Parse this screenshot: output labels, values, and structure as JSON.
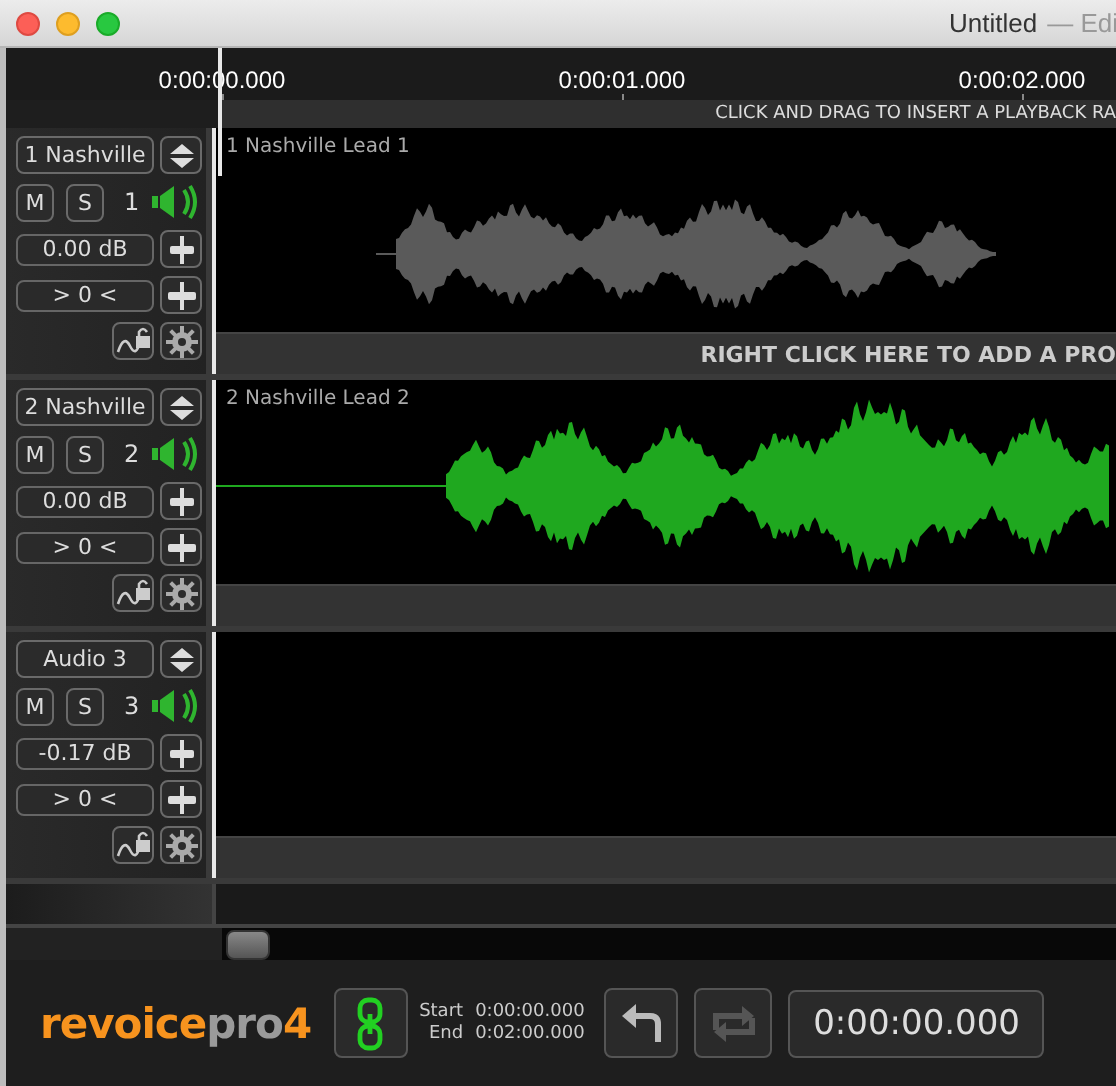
{
  "window": {
    "title": "Untitled",
    "subtitle": "— Edi"
  },
  "ruler": {
    "labels": [
      "0:00:00.000",
      "0:00:01.000",
      "0:00:02.000"
    ]
  },
  "banner": "CLICK AND DRAG TO INSERT A PLAYBACK RA",
  "tracks": [
    {
      "name": "1 Nashville",
      "mute": "M",
      "solo": "S",
      "number": "1",
      "gain": "0.00 dB",
      "pan": "> 0 <",
      "clip": {
        "label": "1 Nashville Lead 1",
        "color": "#5a5a5a"
      },
      "hint": "RIGHT CLICK HERE TO ADD A PRO"
    },
    {
      "name": "2 Nashville",
      "mute": "M",
      "solo": "S",
      "number": "2",
      "gain": "0.00 dB",
      "pan": "> 0 <",
      "clip": {
        "label": "2 Nashville Lead 2",
        "color": "#1fa81f"
      }
    },
    {
      "name": "Audio 3",
      "mute": "M",
      "solo": "S",
      "number": "3",
      "gain": "-0.17 dB",
      "pan": "> 0 <"
    }
  ],
  "toolbar": {
    "logo": {
      "brand": "revoice",
      "product": "pro",
      "version": "4"
    },
    "range": [
      {
        "label": "Start",
        "value": "0:00:00.000"
      },
      {
        "label": "End",
        "value": "0:02:00.000"
      }
    ],
    "loop_disabled": true,
    "time": "0:00:00.000"
  }
}
